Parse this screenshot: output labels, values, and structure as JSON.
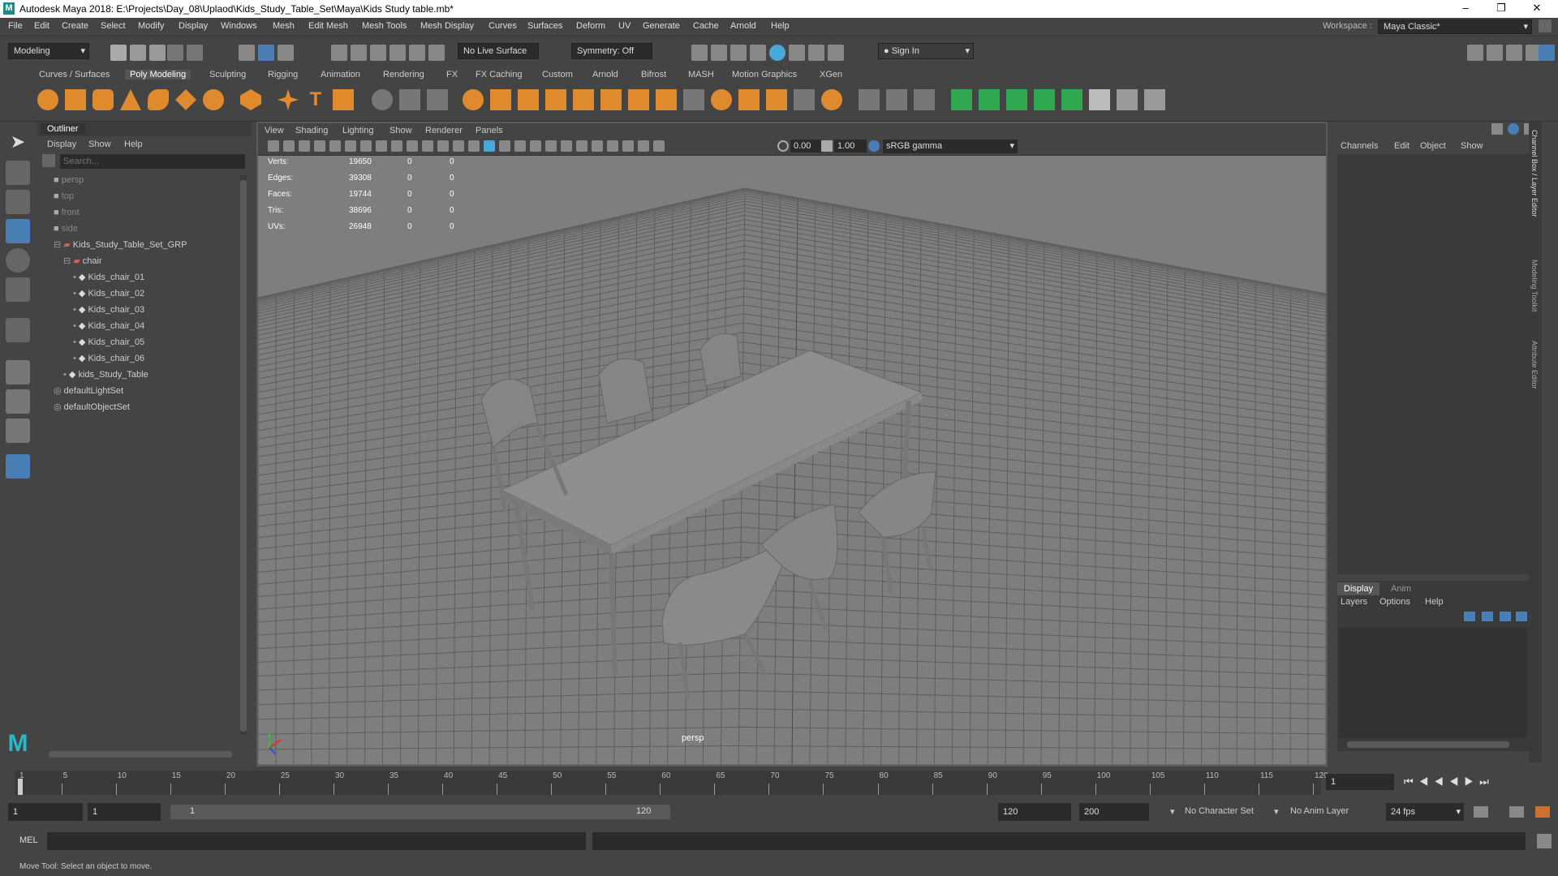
{
  "window": {
    "title": "Autodesk Maya 2018: E:\\Projects\\Day_08\\Uplaod\\Kids_Study_Table_Set\\Maya\\Kids Study table.mb*",
    "logo": "M"
  },
  "menus": [
    "File",
    "Edit",
    "Create",
    "Select",
    "Modify",
    "Display",
    "Windows",
    "Mesh",
    "Edit Mesh",
    "Mesh Tools",
    "Mesh Display",
    "Curves",
    "Surfaces",
    "Deform",
    "UV",
    "Generate",
    "Cache",
    "Arnold",
    "Help"
  ],
  "workspace": {
    "label": "Workspace :",
    "value": "Maya Classic*"
  },
  "statusline": {
    "mode": "Modeling",
    "live_surface": "No Live Surface",
    "symmetry": "Symmetry: Off",
    "sign_in": "Sign In"
  },
  "shelf_tabs": [
    "Curves / Surfaces",
    "Poly Modeling",
    "Sculpting",
    "Rigging",
    "Animation",
    "Rendering",
    "FX",
    "FX Caching",
    "Custom",
    "Arnold",
    "Bifrost",
    "MASH",
    "Motion Graphics",
    "XGen"
  ],
  "shelf_active": "Poly Modeling",
  "outliner": {
    "title": "Outliner",
    "menu": [
      "Display",
      "Show",
      "Help"
    ],
    "search_placeholder": "Search...",
    "items": [
      {
        "label": "persp",
        "indent": 0,
        "type": "camera",
        "dim": true
      },
      {
        "label": "top",
        "indent": 0,
        "type": "camera",
        "dim": true
      },
      {
        "label": "front",
        "indent": 0,
        "type": "camera",
        "dim": true
      },
      {
        "label": "side",
        "indent": 0,
        "type": "camera",
        "dim": true
      },
      {
        "label": "Kids_Study_Table_Set_GRP",
        "indent": 0,
        "type": "group",
        "expand": "-"
      },
      {
        "label": "chair",
        "indent": 1,
        "type": "group",
        "expand": "-"
      },
      {
        "label": "Kids_chair_01",
        "indent": 2,
        "type": "mesh",
        "expand": "+"
      },
      {
        "label": "Kids_chair_02",
        "indent": 2,
        "type": "mesh",
        "expand": "+"
      },
      {
        "label": "Kids_chair_03",
        "indent": 2,
        "type": "mesh",
        "expand": "+"
      },
      {
        "label": "Kids_chair_04",
        "indent": 2,
        "type": "mesh",
        "expand": "+"
      },
      {
        "label": "Kids_chair_05",
        "indent": 2,
        "type": "mesh",
        "expand": "+"
      },
      {
        "label": "Kids_chair_06",
        "indent": 2,
        "type": "mesh",
        "expand": "+"
      },
      {
        "label": "kids_Study_Table",
        "indent": 1,
        "type": "mesh",
        "expand": "+"
      },
      {
        "label": "defaultLightSet",
        "indent": 0,
        "type": "set"
      },
      {
        "label": "defaultObjectSet",
        "indent": 0,
        "type": "set"
      }
    ]
  },
  "viewport": {
    "menu": [
      "View",
      "Shading",
      "Lighting",
      "Show",
      "Renderer",
      "Panels"
    ],
    "exposure": "0.00",
    "gamma": "1.00",
    "color_space": "sRGB gamma",
    "camera_label": "persp",
    "hud": [
      {
        "label": "Verts:",
        "v1": "19650",
        "v2": "0",
        "v3": "0"
      },
      {
        "label": "Edges:",
        "v1": "39308",
        "v2": "0",
        "v3": "0"
      },
      {
        "label": "Faces:",
        "v1": "19744",
        "v2": "0",
        "v3": "0"
      },
      {
        "label": "Tris:",
        "v1": "38696",
        "v2": "0",
        "v3": "0"
      },
      {
        "label": "UVs:",
        "v1": "26948",
        "v2": "0",
        "v3": "0"
      }
    ]
  },
  "channel_box": {
    "menu": [
      "Channels",
      "Edit",
      "Object",
      "Show"
    ],
    "side_tabs": [
      "Channel Box / Layer Editor",
      "Modeling Toolkit",
      "Attribute Editor"
    ]
  },
  "layer_editor": {
    "tabs": [
      "Display",
      "Anim"
    ],
    "menu": [
      "Layers",
      "Options",
      "Help"
    ]
  },
  "timeline": {
    "ticks": [
      "1",
      "5",
      "10",
      "15",
      "20",
      "25",
      "30",
      "35",
      "40",
      "45",
      "50",
      "55",
      "60",
      "65",
      "70",
      "75",
      "80",
      "85",
      "90",
      "95",
      "100",
      "105",
      "110",
      "115",
      "120"
    ],
    "current_frame": "1"
  },
  "range": {
    "start": "1",
    "anim_start": "1",
    "slider_start": "1",
    "slider_end": "120",
    "end": "120",
    "anim_end": "200",
    "character_set": "No Character Set",
    "anim_layer": "No Anim Layer",
    "fps": "24 fps"
  },
  "command": {
    "label": "MEL"
  },
  "help_line": "Move Tool: Select an object to move."
}
